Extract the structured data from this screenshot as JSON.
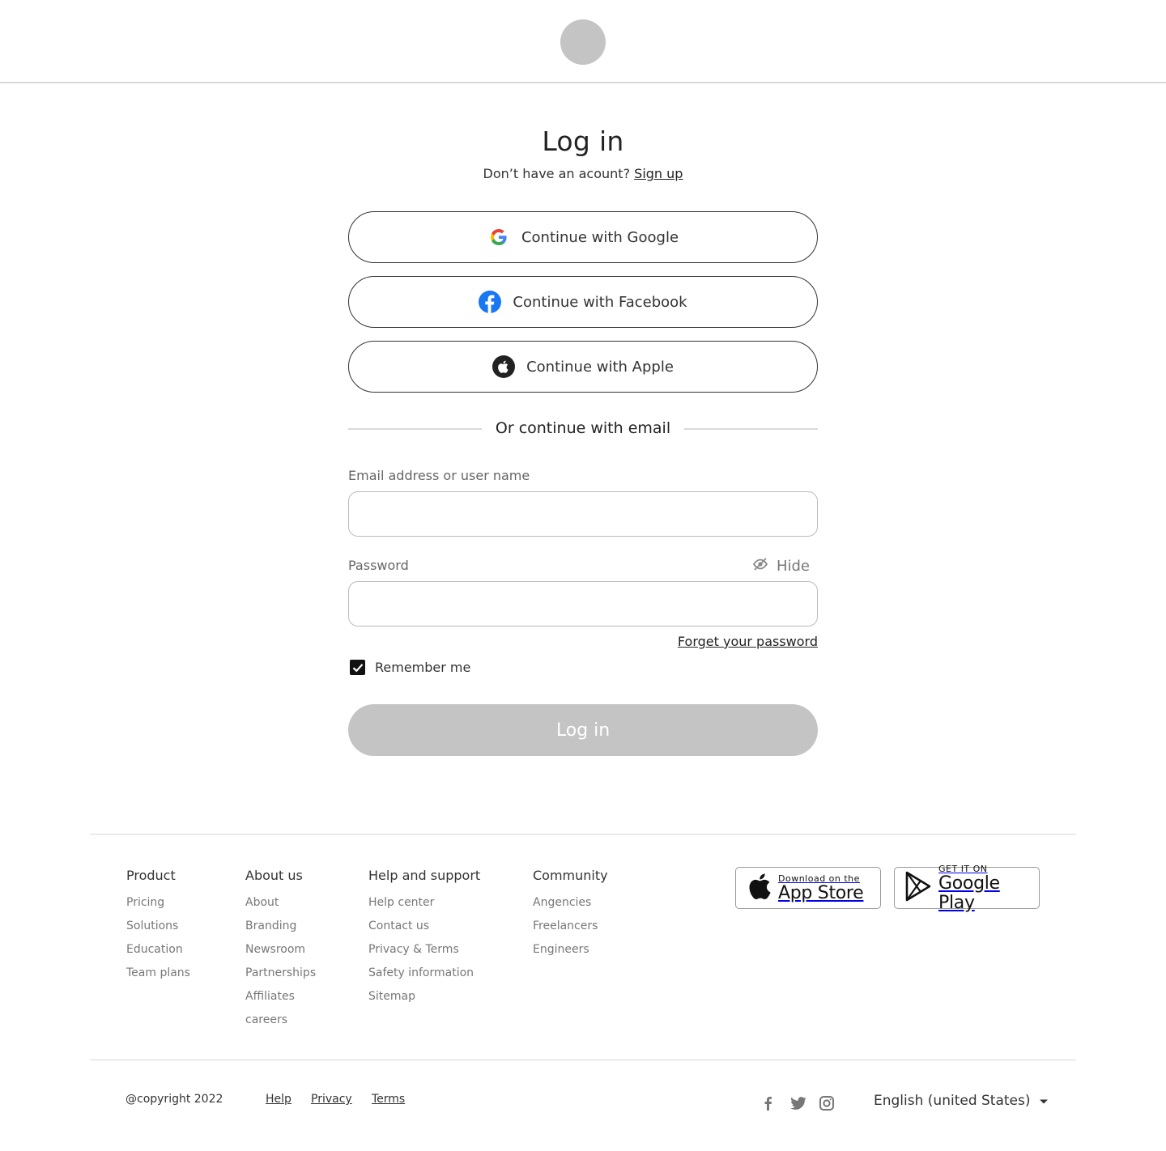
{
  "login": {
    "title": "Log in",
    "subtitle_prefix": "Don’t have an acount?",
    "signup_link": "Sign up",
    "google_btn": "Continue with Google",
    "facebook_btn": "Continue with Facebook",
    "apple_btn": "Continue with Apple",
    "divider_text": "Or continue with email",
    "email_label": "Email address or user name",
    "email_value": "",
    "password_label": "Password",
    "password_value": "",
    "hide_label": "Hide",
    "forgot_link": "Forget your password",
    "remember_label": "Remember me",
    "remember_checked": true,
    "submit_label": "Log in"
  },
  "footer": {
    "columns": [
      {
        "heading": "Product",
        "links": [
          "Pricing",
          "Solutions",
          "Education",
          "Team plans"
        ]
      },
      {
        "heading": "About us",
        "links": [
          "About",
          "Branding",
          "Newsroom",
          "Partnerships",
          "Affiliates",
          "careers"
        ]
      },
      {
        "heading": "Help and support",
        "links": [
          "Help center",
          "Contact us",
          "Privacy & Terms",
          "Safety information",
          "Sitemap"
        ]
      },
      {
        "heading": "Community",
        "links": [
          "Angencies",
          "Freelancers",
          "Engineers"
        ]
      }
    ],
    "app_store": {
      "small": "Download on the",
      "big": "App Store"
    },
    "google_play": {
      "small": "GET IT ON",
      "big": "Google Play"
    },
    "copyright": "@copyright 2022",
    "bottom_links": [
      "Help",
      "Privacy",
      "Terms"
    ],
    "language": "English (united States)"
  },
  "colors": {
    "accent_gray": "#c4c4c4",
    "facebook_blue": "#1877f2"
  }
}
